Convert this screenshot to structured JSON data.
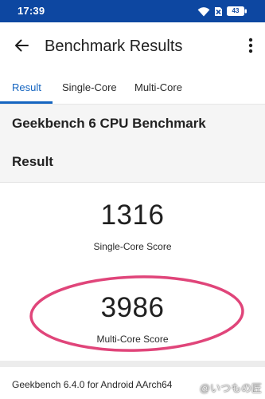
{
  "status_bar": {
    "time": "17:39",
    "battery_level": "43",
    "icons": [
      "wifi-icon",
      "sim-off-icon",
      "battery-icon"
    ]
  },
  "app_bar": {
    "title": "Benchmark Results",
    "back_icon": "arrow-left-icon",
    "more_icon": "more-vertical-icon"
  },
  "tabs": [
    {
      "label": "Result",
      "selected": true
    },
    {
      "label": "Single-Core",
      "selected": false
    },
    {
      "label": "Multi-Core",
      "selected": false
    }
  ],
  "header": {
    "benchmark_title": "Geekbench 6 CPU Benchmark",
    "section_title": "Result"
  },
  "scores": {
    "single_core": {
      "value": "1316",
      "label": "Single-Core Score"
    },
    "multi_core": {
      "value": "3986",
      "label": "Multi-Core Score"
    }
  },
  "footer": {
    "version_text": "Geekbench 6.4.0 for Android AArch64"
  },
  "watermark": "@いつもの匠",
  "colors": {
    "status_bar": "#0d47a1",
    "accent": "#1565c0",
    "highlight": "#e0457a"
  }
}
